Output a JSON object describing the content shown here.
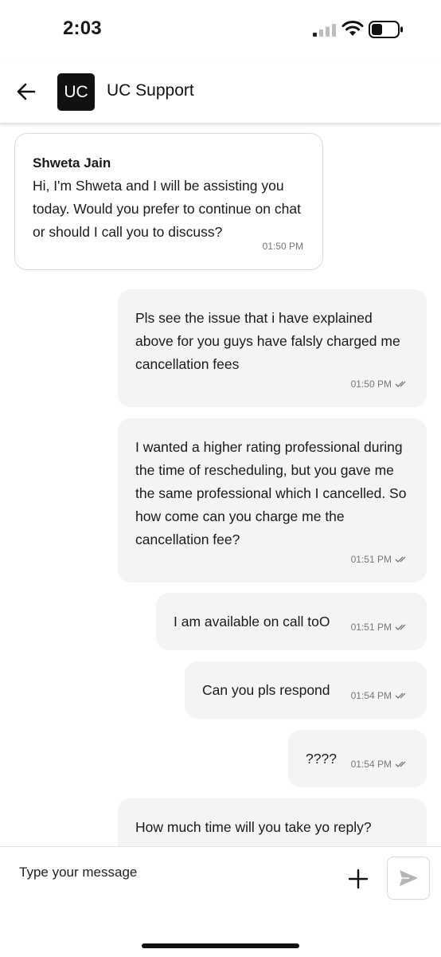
{
  "status": {
    "time": "2:03"
  },
  "header": {
    "avatar_text": "UC",
    "title": "UC Support"
  },
  "messages": [
    {
      "sender": "Shweta Jain",
      "text": "Hi, I'm Shweta and I will be assisting you today. Would you prefer to continue on chat or should I call you to discuss?",
      "time": "01:50 PM"
    },
    {
      "text": "Pls see the issue that i have explained above for you guys have falsly charged me cancellation fees",
      "time": "01:50 PM"
    },
    {
      "text": "I wanted a higher rating professional during the time of rescheduling, but you gave me the same professional which I cancelled. So how come can you charge me the cancellation fee?",
      "time": "01:51 PM"
    },
    {
      "text": "I am available on call toO",
      "time": "01:51 PM"
    },
    {
      "text": "Can you pls respond",
      "time": "01:54 PM"
    },
    {
      "text": "????",
      "time": "01:54 PM"
    },
    {
      "text": "How much time will you take yo reply?"
    }
  ],
  "composer": {
    "placeholder": "Type your message"
  },
  "icons": {
    "back": "arrow-left-icon",
    "plus": "plus-icon",
    "send": "send-icon",
    "read_ticks": "double-check-icon"
  }
}
